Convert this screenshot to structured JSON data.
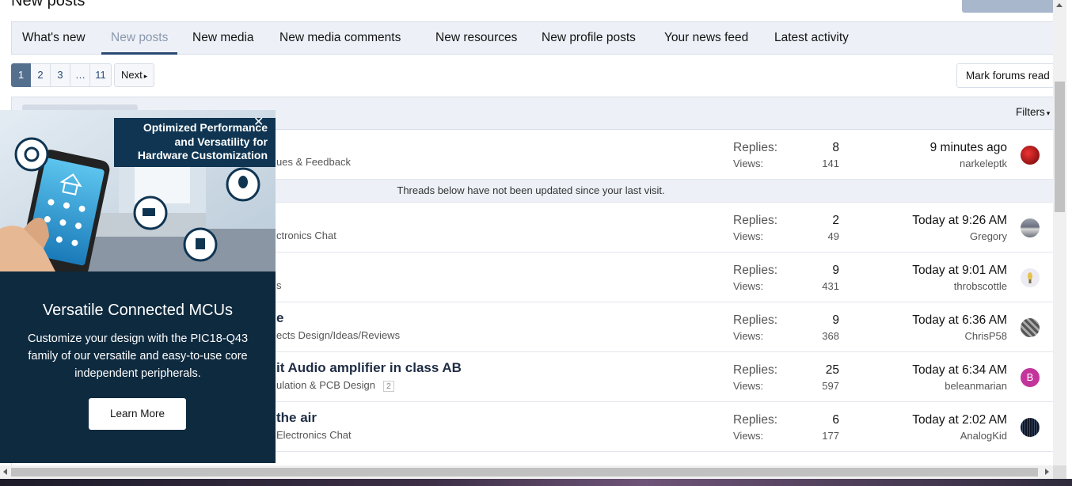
{
  "page": {
    "title_fragment": "New posts"
  },
  "tabs": [
    {
      "label": "What's new",
      "active": false
    },
    {
      "label": "New posts",
      "active": true
    },
    {
      "label": "New media",
      "active": false
    },
    {
      "label": "New media comments",
      "active": false
    },
    {
      "label": "New resources",
      "active": false
    },
    {
      "label": "New profile posts",
      "active": false
    },
    {
      "label": "Your news feed",
      "active": false
    },
    {
      "label": "Latest activity",
      "active": false
    }
  ],
  "pagination": {
    "pages": [
      "1",
      "2",
      "3",
      "…",
      "11"
    ],
    "current": "1",
    "next_label": "Next"
  },
  "toolbar": {
    "mark_read_label": "Mark forums read",
    "filters_label": "Filters"
  },
  "divider_text": "Threads below have not been updated since your last visit.",
  "threads": [
    {
      "title": "",
      "forum": "ues & Feedback",
      "pages": "",
      "replies_label": "Replies:",
      "replies": "8",
      "views_label": "Views:",
      "views": "141",
      "time": "9 minutes ago",
      "user": "narkeleptk",
      "avatar_color": "#c0282a",
      "avatar_letter": ""
    },
    {
      "title": "",
      "forum": "ctronics Chat",
      "pages": "",
      "replies_label": "Replies:",
      "replies": "2",
      "views_label": "Views:",
      "views": "49",
      "time": "Today at 9:26 AM",
      "user": "Gregory",
      "avatar_color": "#7a7f8c",
      "avatar_letter": ""
    },
    {
      "title": "",
      "forum": "s",
      "pages": "",
      "replies_label": "Replies:",
      "replies": "9",
      "views_label": "Views:",
      "views": "431",
      "time": "Today at 9:01 AM",
      "user": "throbscottle",
      "avatar_color": "#e8e6ef",
      "avatar_letter": ""
    },
    {
      "title": "e",
      "forum": "ects Design/Ideas/Reviews",
      "pages": "",
      "replies_label": "Replies:",
      "replies": "9",
      "views_label": "Views:",
      "views": "368",
      "time": "Today at 6:36 AM",
      "user": "ChrisP58",
      "avatar_color": "#8c8c8c",
      "avatar_letter": ""
    },
    {
      "title": "it Audio amplifier in class AB",
      "forum": "ulation & PCB Design",
      "pages": "2",
      "replies_label": "Replies:",
      "replies": "25",
      "views_label": "Views:",
      "views": "597",
      "time": "Today at 6:34 AM",
      "user": "beleanmarian",
      "avatar_color": "#c2359a",
      "avatar_letter": "B"
    },
    {
      "title": "the air",
      "forum": "Electronics Chat",
      "pages": "",
      "replies_label": "Replies:",
      "replies": "6",
      "views_label": "Views:",
      "views": "177",
      "time": "Today at 2:02 AM",
      "user": "AnalogKid",
      "avatar_color": "#1c2434",
      "avatar_letter": ""
    }
  ],
  "ad": {
    "headline_lines": [
      "Optimized Performance",
      "and Versatility for",
      "Hardware Customization"
    ],
    "title": "Versatile Connected MCUs",
    "description": "Customize your design with the PIC18-Q43 family of our versatile and easy-to-use core independent peripherals.",
    "button_label": "Learn More",
    "close_glyph": "✕"
  },
  "colors": {
    "accent": "#2a4a73",
    "tab_bar": "#edf1f7",
    "ad_bg": "#0e2a3f",
    "pagination_current": "#55708f"
  }
}
